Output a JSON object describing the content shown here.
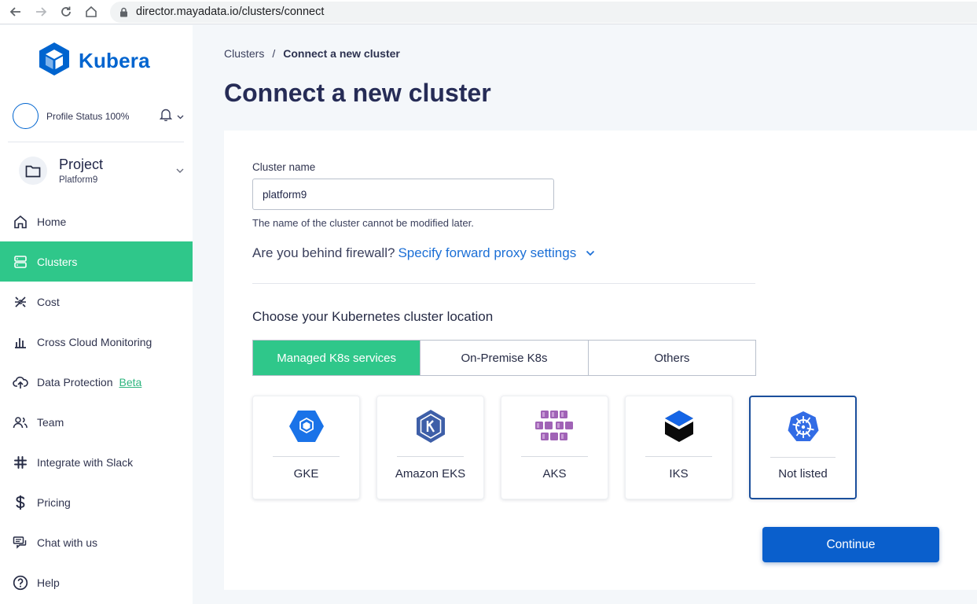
{
  "browser": {
    "url": "director.mayadata.io/clusters/connect",
    "icons": [
      "back-icon",
      "forward-icon",
      "reload-icon",
      "home-icon",
      "lock-icon"
    ]
  },
  "sidebar": {
    "logo_text": "Kubera",
    "profile_status": "Profile Status 100%",
    "project": {
      "title": "Project",
      "subtitle": "Platform9"
    },
    "items": [
      {
        "label": "Home",
        "icon": "home-icon",
        "active": false
      },
      {
        "label": "Clusters",
        "icon": "server-icon",
        "active": true
      },
      {
        "label": "Cost",
        "icon": "cost-icon",
        "active": false
      },
      {
        "label": "Cross Cloud Monitoring",
        "icon": "bar-chart-icon",
        "active": false
      },
      {
        "label": "Data Protection",
        "icon": "cloud-upload-icon",
        "active": false,
        "badge": "Beta"
      },
      {
        "label": "Team",
        "icon": "team-icon",
        "active": false
      },
      {
        "label": "Integrate with Slack",
        "icon": "slack-icon",
        "active": false
      },
      {
        "label": "Pricing",
        "icon": "dollar-icon",
        "active": false
      },
      {
        "label": "Chat with us",
        "icon": "chat-icon",
        "active": false
      },
      {
        "label": "Help",
        "icon": "help-icon",
        "active": false
      }
    ]
  },
  "breadcrumb": {
    "parent": "Clusters",
    "separator": "/",
    "current": "Connect a new cluster"
  },
  "page_title": "Connect a new cluster",
  "form": {
    "cluster_name_label": "Cluster name",
    "cluster_name_value": "platform9",
    "cluster_name_help": "The name of the cluster cannot be modified later.",
    "firewall_question": "Are you behind firewall?",
    "proxy_link": "Specify forward proxy settings",
    "location_title": "Choose your Kubernetes cluster location",
    "tabs": [
      {
        "label": "Managed K8s services",
        "active": true
      },
      {
        "label": "On-Premise K8s",
        "active": false
      },
      {
        "label": "Others",
        "active": false
      }
    ],
    "providers": [
      {
        "label": "GKE",
        "icon": "gke-icon",
        "selected": false
      },
      {
        "label": "Amazon EKS",
        "icon": "eks-icon",
        "selected": false
      },
      {
        "label": "AKS",
        "icon": "aks-icon",
        "selected": false
      },
      {
        "label": "IKS",
        "icon": "iks-icon",
        "selected": false
      },
      {
        "label": "Not listed",
        "icon": "kubernetes-icon",
        "selected": true
      }
    ],
    "continue_label": "Continue"
  },
  "colors": {
    "accent_green": "#2fc78a",
    "primary_blue": "#0a5fcc",
    "brand_blue": "#0064cf",
    "title_navy": "#262c56"
  }
}
